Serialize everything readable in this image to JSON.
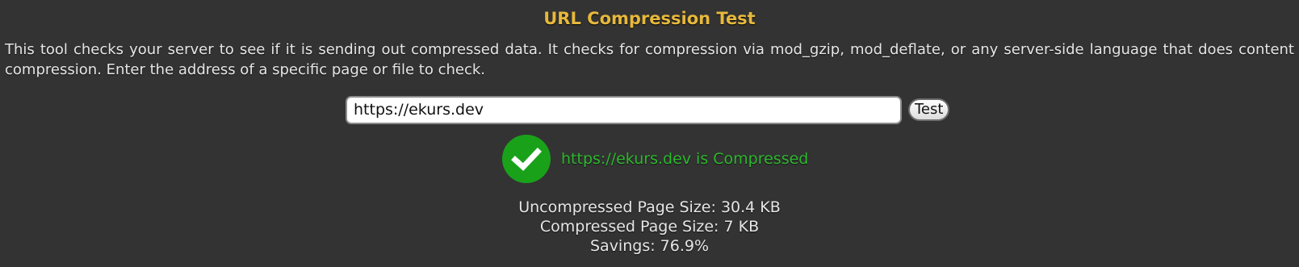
{
  "header": {
    "title": "URL Compression Test"
  },
  "description": "This tool checks your server to see if it is sending out compressed data. It checks for compression via mod_gzip, mod_deflate, or any server-side language that does content compression. Enter the address of a specific page or file to check.",
  "form": {
    "url_value": "https://ekurs.dev",
    "test_label": "Test"
  },
  "result": {
    "status_icon": "check-circle-icon",
    "message": "https://ekurs.dev is Compressed",
    "color": "#1aa11a"
  },
  "stats": {
    "uncompressed": "Uncompressed Page Size: 30.4 KB",
    "compressed": "Compressed Page Size: 7 KB",
    "savings": "Savings: 76.9%"
  },
  "colors": {
    "background": "#333333",
    "title": "#e6b83c",
    "success": "#2db82d"
  }
}
